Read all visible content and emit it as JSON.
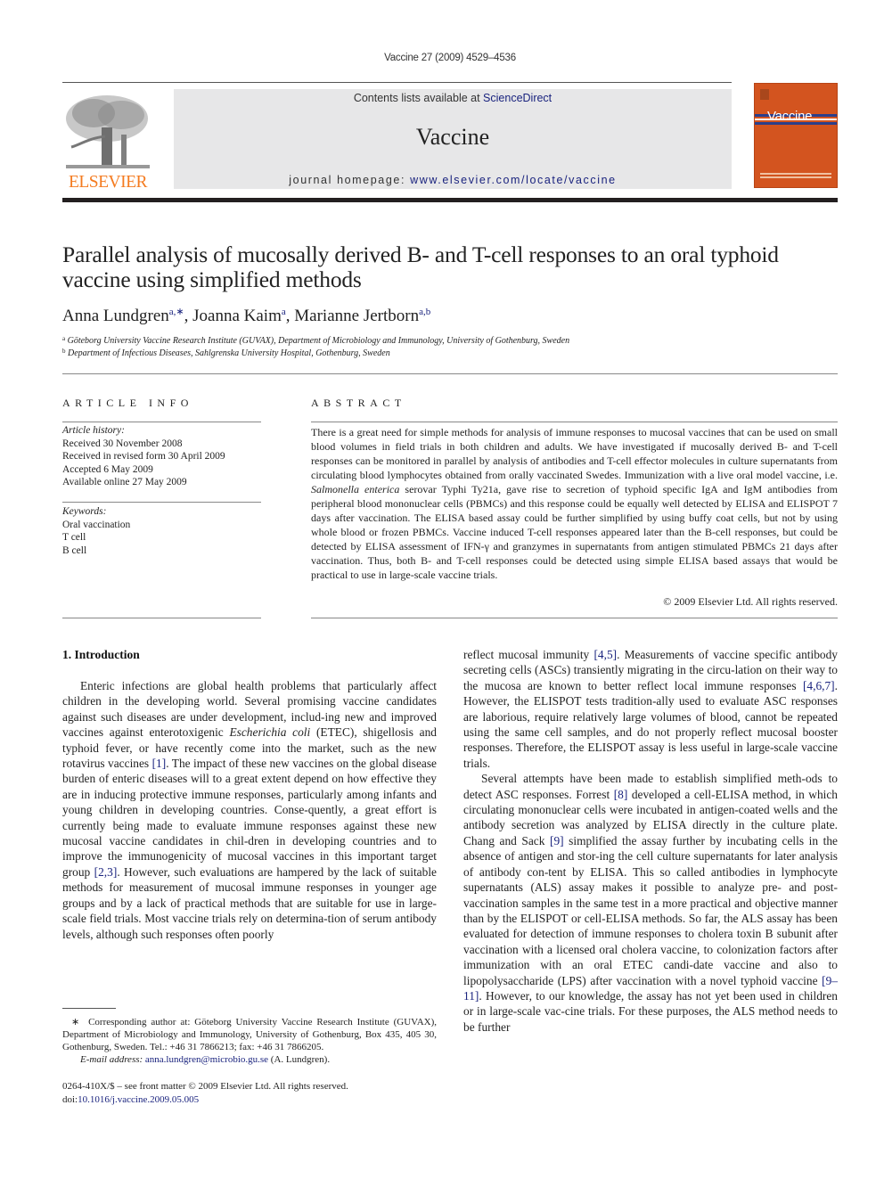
{
  "header": {
    "running_citation": "Vaccine 27 (2009) 4529–4536",
    "contents_prefix": "Contents lists available at ",
    "contents_link": "ScienceDirect",
    "journal_name": "Vaccine",
    "homepage_prefix": "journal homepage: ",
    "homepage_link": "www.elsevier.com/locate/vaccine",
    "publisher_logo_text": "ELSEVIER",
    "cover_title": "Vaccine",
    "colors": {
      "publisher_orange": "#f47b20",
      "cover_orange": "#d3541f",
      "link_blue": "#1a237e",
      "banner_gray": "#e7e7e8"
    }
  },
  "article": {
    "title": "Parallel analysis of mucosally derived B- and T-cell responses to an oral typhoid vaccine using simplified methods",
    "authors": [
      {
        "name": "Anna Lundgren",
        "affil": "a,∗"
      },
      {
        "name": "Joanna Kaim",
        "affil": "a"
      },
      {
        "name": "Marianne Jertborn",
        "affil": "a,b"
      }
    ],
    "affiliations": [
      {
        "mark": "a",
        "text": "Göteborg University Vaccine Research Institute (GUVAX), Department of Microbiology and Immunology, University of Gothenburg, Sweden"
      },
      {
        "mark": "b",
        "text": "Department of Infectious Diseases, Sahlgrenska University Hospital, Gothenburg, Sweden"
      }
    ]
  },
  "article_info": {
    "heading": "ARTICLE INFO",
    "history_label": "Article history:",
    "history": [
      "Received 30 November 2008",
      "Received in revised form 30 April 2009",
      "Accepted 6 May 2009",
      "Available online 27 May 2009"
    ],
    "keywords_label": "Keywords:",
    "keywords": [
      "Oral vaccination",
      "T cell",
      "B cell"
    ]
  },
  "abstract": {
    "heading": "ABSTRACT",
    "text_1": "There is a great need for simple methods for analysis of immune responses to mucosal vaccines that can be used on small blood volumes in field trials in both children and adults. We have investigated if mucosally derived B- and T-cell responses can be monitored in parallel by analysis of antibodies and T-cell effector molecules in culture supernatants from circulating blood lymphocytes obtained from orally vaccinated Swedes. Immunization with a live oral model vaccine, i.e. ",
    "text_italic": "Salmonella enterica",
    "text_2": " serovar Typhi Ty21a, gave rise to secretion of typhoid specific IgA and IgM antibodies from peripheral blood mononuclear cells (PBMCs) and this response could be equally well detected by ELISA and ELISPOT 7 days after vaccination. The ELISA based assay could be further simplified by using buffy coat cells, but not by using whole blood or frozen PBMCs. Vaccine induced T-cell responses appeared later than the B-cell responses, but could be detected by ELISA assessment of IFN-γ and granzymes in supernatants from antigen stimulated PBMCs 21 days after vaccination. Thus, both B- and T-cell responses could be detected using simple ELISA based assays that would be practical to use in large-scale vaccine trials.",
    "copyright": "© 2009 Elsevier Ltd. All rights reserved."
  },
  "body": {
    "section_heading": "1.  Introduction",
    "left_p1_a": "Enteric infections are global health problems that particularly affect children in the developing world. Several promising vaccine candidates against such diseases are under development, includ-ing new and improved vaccines against enterotoxigenic ",
    "left_p1_it": "Escherichia coli",
    "left_p1_b": " (ETEC), shigellosis and typhoid fever, or have recently come into the market, such as the new rotavirus vaccines ",
    "ref_1": "[1]",
    "left_p1_c": ". The impact of these new vaccines on the global disease burden of enteric diseases will to a great extent depend on how effective they are in inducing protective immune responses, particularly among infants and young children in developing countries. Conse-quently, a great effort is currently being made to evaluate immune responses against these new mucosal vaccine candidates in chil-dren in developing countries and to improve the immunogenicity of mucosal vaccines in this important target group ",
    "ref_2": "[2,3]",
    "left_p1_d": ". However, such evaluations are hampered by the lack of suitable methods for measurement of mucosal immune responses in younger age groups and by a lack of practical methods that are suitable for use in large-scale field trials. Most vaccine trials rely on determina-tion of serum antibody levels, although such responses often poorly",
    "right_p1_a": "reflect mucosal immunity ",
    "ref_3": "[4,5]",
    "right_p1_b": ". Measurements of vaccine specific antibody secreting cells (ASCs) transiently migrating in the circu-lation on their way to the mucosa are known to better reflect local immune responses ",
    "ref_4": "[4,6,7]",
    "right_p1_c": ". However, the ELISPOT tests tradition-ally used to evaluate ASC responses are laborious, require relatively large volumes of blood, cannot be repeated using the same cell samples, and do not properly reflect mucosal booster responses. Therefore, the ELISPOT assay is less useful in large-scale vaccine trials.",
    "right_p2_a": "Several attempts have been made to establish simplified meth-ods to detect ASC responses. Forrest ",
    "ref_5": "[8]",
    "right_p2_b": " developed a cell-ELISA method, in which circulating mononuclear cells were incubated in antigen-coated wells and the antibody secretion was analyzed by ELISA directly in the culture plate. Chang and Sack ",
    "ref_6": "[9]",
    "right_p2_c": " simplified the assay further by incubating cells in the absence of antigen and stor-ing the cell culture supernatants for later analysis of antibody con-tent by ELISA. This so called antibodies in lymphocyte supernatants (ALS) assay makes it possible to analyze pre- and post-vaccination samples in the same test in a more practical and objective manner than by the ELISPOT or cell-ELISA methods. So far, the ALS assay has been evaluated for detection of immune responses to cholera toxin B subunit after vaccination with a licensed oral cholera vaccine, to colonization factors after immunization with an oral ETEC candi-date vaccine and also to lipopolysaccharide (LPS) after vaccination with a novel typhoid vaccine ",
    "ref_7": "[9–11]",
    "right_p2_d": ". However, to our knowledge, the assay has not yet been used in children or in large-scale vac-cine trials. For these purposes, the ALS method needs to be further"
  },
  "footnote": {
    "mark": "∗",
    "text": "Corresponding author at: Göteborg University Vaccine Research Institute (GUVAX), Department of Microbiology and Immunology, University of Gothenburg, Box 435, 405 30, Gothenburg, Sweden. Tel.: +46 31 7866213; fax: +46 31 7866205.",
    "email_label": "E-mail address:",
    "email": "anna.lundgren@microbio.gu.se",
    "email_suffix": " (A. Lundgren)."
  },
  "front_matter": {
    "issn_line": "0264-410X/$ – see front matter © 2009 Elsevier Ltd. All rights reserved.",
    "doi_prefix": "doi:",
    "doi": "10.1016/j.vaccine.2009.05.005"
  }
}
